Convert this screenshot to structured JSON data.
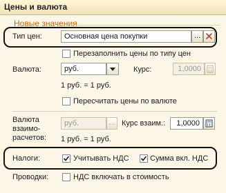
{
  "window": {
    "title": "Цены и валюта"
  },
  "group": {
    "caption": "Новые значения"
  },
  "price_type": {
    "label": "Тип цен:",
    "value": "Основная цена покупки",
    "select_btn": "...",
    "clear_icon": "close-icon"
  },
  "refill_prices": {
    "label": "Перезаполнить цены по типу цен",
    "checked": false
  },
  "currency": {
    "label": "Валюта:",
    "value": "руб.",
    "rate_label": "Курс:",
    "rate_value": "1,0000",
    "conversion_text": "1 руб. = 1 руб."
  },
  "recalc_prices": {
    "label": "Пересчитать цены по валюте",
    "checked": false
  },
  "settlement_currency": {
    "label_line1": "Валюта",
    "label_line2": "взаимо-",
    "label_line3": "расчетов:",
    "value": "руб.",
    "select_btn": "...",
    "rate_label": "Курс взаим.:",
    "rate_value": "1,0000",
    "conversion_text": "1 руб. = 1 руб."
  },
  "taxes": {
    "label": "Налоги:",
    "account_vat": {
      "label": "Учитывать НДС",
      "checked": true
    },
    "sum_incl_vat": {
      "label": "Сумма вкл. НДС",
      "checked": true
    }
  },
  "postings": {
    "label": "Проводки:",
    "include_vat": {
      "label": "НДС включать в стоимость",
      "checked": false
    }
  }
}
